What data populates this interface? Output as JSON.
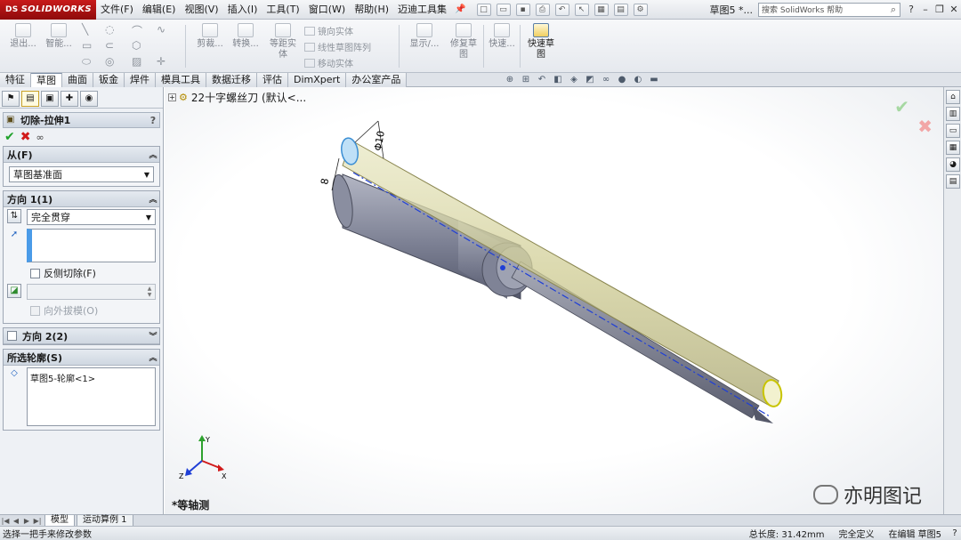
{
  "app": {
    "logo": "SOLIDWORKS",
    "logo_prefix": "DS",
    "doc_title": "草图5 *...",
    "help_search_placeholder": "搜索 SolidWorks 帮助"
  },
  "menu": {
    "items": [
      "文件(F)",
      "编辑(E)",
      "视图(V)",
      "插入(I)",
      "工具(T)",
      "窗口(W)",
      "帮助(H)",
      "迈迪工具集"
    ]
  },
  "command_bar": {
    "exit_sketch": "退出...",
    "smart_dim": "智能...",
    "trim": "剪裁...",
    "convert": "转换...",
    "offset_line1": "等距实",
    "offset_line2": "体",
    "mirror": "镜向实体",
    "linear_pattern": "线性草图阵列",
    "move": "移动实体",
    "display": "显示/...",
    "repair_line1": "修复草",
    "repair_line2": "图",
    "quick_snaps": "快速...",
    "rapid_sketch_line1": "快速草",
    "rapid_sketch_line2": "图"
  },
  "tabs": [
    "特征",
    "草图",
    "曲面",
    "钣金",
    "焊件",
    "模具工具",
    "数据迁移",
    "评估",
    "DimXpert",
    "办公室产品"
  ],
  "active_tab": "草图",
  "property_manager": {
    "feature_title": "切除-拉伸1",
    "help": "?",
    "from_group": {
      "title": "从(F)",
      "start_condition": "草图基准面"
    },
    "direction1_group": {
      "title": "方向 1(1)",
      "end_condition": "完全贯穿",
      "flip_side_label": "反侧切除(F)",
      "flip_side_checked": false,
      "draft_outward_label": "向外拔模(O)",
      "draft_outward_checked": false
    },
    "direction2_group": {
      "title": "方向 2(2)",
      "checked": false
    },
    "contours_group": {
      "title": "所选轮廓(S)",
      "items": [
        "草图5-轮廓<1>"
      ]
    }
  },
  "graphics": {
    "tree_item": "22十字螺丝刀 (默认<...",
    "view_name": "*等轴测",
    "dimension_1": "Φ10",
    "dimension_2": "8",
    "triad_labels": {
      "x": "X",
      "y": "Y",
      "z": "Z"
    }
  },
  "watermark": "亦明图记",
  "bottom_tabs": [
    "模型",
    "运动算例 1"
  ],
  "status": {
    "message": "选择一把手来修改参数",
    "total_length": "总长度: 31.42mm",
    "definition": "完全定义",
    "editing": "在编辑 草图5",
    "help_icon": "?"
  },
  "colors": {
    "brand": "#b41414",
    "handle": "#d8d6a8",
    "shaft": "#8f93a4",
    "accept": "#1fa12a",
    "reject": "#d11b1b"
  }
}
